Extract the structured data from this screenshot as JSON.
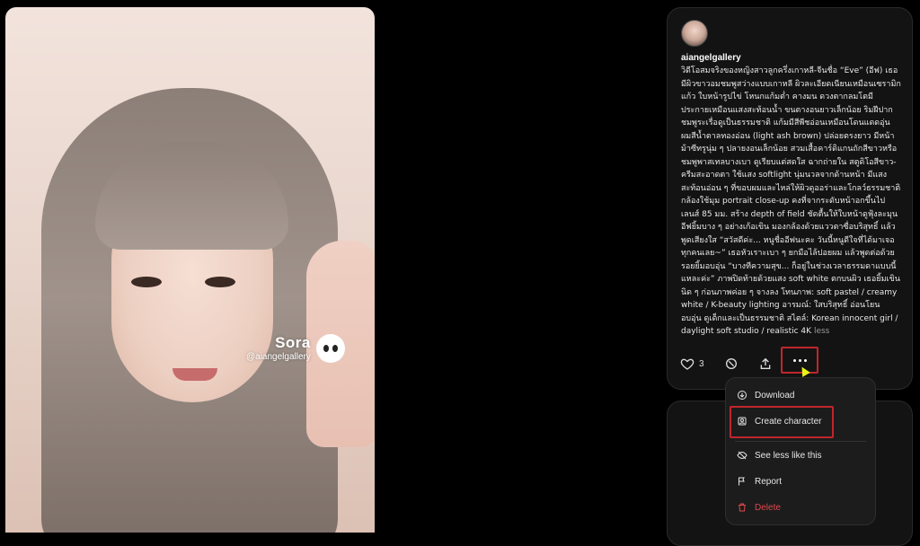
{
  "video": {
    "watermark_name": "Sora",
    "watermark_handle": "@aiangelgallery"
  },
  "post": {
    "username": "aiangelgallery",
    "caption": "วิดีโอสมจริงของหญิงสาวลูกครึ่งเกาหลี-จีนชื่อ “Eve” (อีฟ) เธอมีผิวขาวอมชมพูสว่างแบบเกาหลี ผิวละเอียดเนียนเหมือนเซรามิกแก้ว ใบหน้ารูปไข่ โหนกแก้มต่ำ คางมน ดวงตากลมโตมีประกายเหมือนแสงสะท้อนน้ำ ขนตางอนยาวเล็กน้อย ริมฝีปากชมพูระเรื่อดูเป็นธรรมชาติ แก้มมีสีพีชอ่อนเหมือนโดนแดดอุ่น ผมสีน้ำตาลทองอ่อน (light ash brown) ปล่อยตรงยาว มีหน้าม้าซีทรูนุ่ม ๆ ปลายงอนเล็กน้อย สวมเสื้อคาร์ดิแกนถักสีขาวหรือชมพูพาสเทลบางเบา ดูเรียบแต่สดใส ฉากถ่ายใน สตูดิโอสีขาว-ครีมสะอาดตา ใช้แสง softlight นุ่มนวลจากด้านหน้า มีแสงสะท้อนอ่อน ๆ ที่ขอบผมและไหล่ให้ผิวดูออร่าและโกลว์ธรรมชาติ กล้องใช้มุม portrait close-up คงที่จากระดับหน้าอกขึ้นไป เลนส์ 85 มม. สร้าง depth of field ชัดตื้นให้ใบหน้าดูฟุ้งละมุน อีฟยิ้มบาง ๆ อย่างเก้อเขิน มองกล้องด้วยแววตาซื่อบริสุทธิ์ แล้วพูดเสียงใส “สวัสดีค่ะ... หนูชื่ออีฟนะคะ วันนี้หนูดีใจที่ได้มาเจอทุกคนเลย~” เธอหัวเราะเบา ๆ ยกมือไล้ปอยผม แล้วพูดต่อด้วยรอยยิ้มอบอุ่น “บางทีความสุข... ก็อยู่ในช่วงเวลาธรรมดาแบบนี้แหละค่ะ” ภาพปิดท้ายด้วยแสง soft white ตกบนผิว เธอยิ้มเขินนิด ๆ ก่อนภาพค่อย ๆ จางลง โทนภาพ: soft pastel / creamy white / K-beauty lighting อารมณ์: ใสบริสุทธิ์ อ่อนโยน อบอุ่น ดูเด็กและเป็นธรรมชาติ สไตล์: Korean innocent girl / daylight soft studio / realistic 4K",
    "less_label": "less",
    "like_count": "3"
  },
  "menu": {
    "download": "Download",
    "create_character": "Create character",
    "see_less": "See less like this",
    "report": "Report",
    "delete": "Delete"
  },
  "colors": {
    "highlight": "#c0262d",
    "delete": "#e0474c",
    "card_bg": "#131313"
  }
}
